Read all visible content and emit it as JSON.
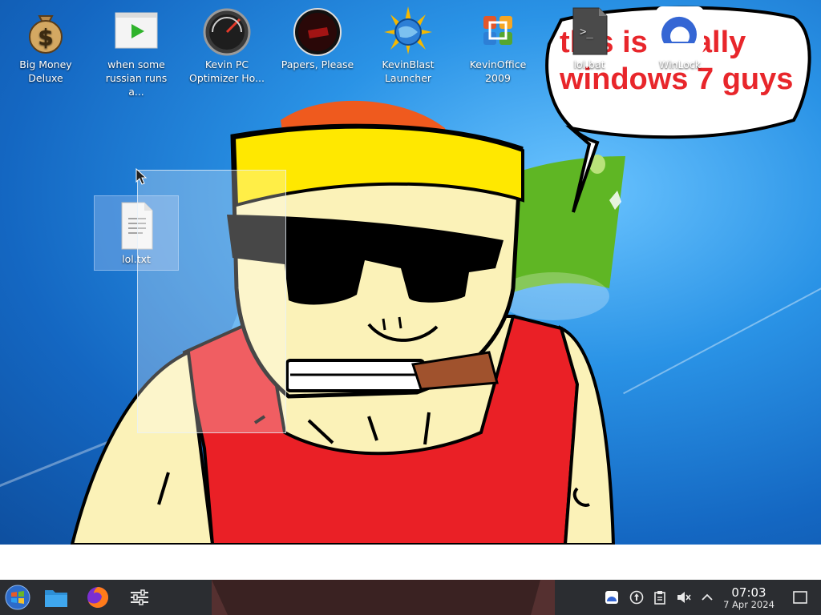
{
  "desktop": {
    "icons": [
      {
        "label": "Big Money Deluxe",
        "icon": "money-bag-icon"
      },
      {
        "label": "when some russian runs a...",
        "icon": "video-play-icon"
      },
      {
        "label": "Kevin PC Optimizer Ho...",
        "icon": "speedometer-icon"
      },
      {
        "label": "Papers, Please",
        "icon": "papers-please-icon"
      },
      {
        "label": "KevinBlast Launcher",
        "icon": "sun-globe-icon"
      },
      {
        "label": "KevinOffice 2009",
        "icon": "office-icon"
      },
      {
        "label": "lol.bat",
        "icon": "terminal-script-icon"
      },
      {
        "label": "WinLock",
        "icon": "lock-app-icon"
      },
      {
        "label": "lol.txt",
        "icon": "text-file-icon",
        "selected": true
      }
    ],
    "bubble": {
      "line1": "this is totally",
      "line2": "windows 7 guys"
    }
  },
  "taskbar": {
    "launchers": [
      {
        "name": "start-menu",
        "icon": "windows-orb-icon"
      },
      {
        "name": "file-manager",
        "icon": "folder-icon"
      },
      {
        "name": "firefox",
        "icon": "firefox-icon"
      },
      {
        "name": "settings",
        "icon": "sliders-icon"
      }
    ],
    "tray": [
      {
        "icon": "winlock-tray-icon"
      },
      {
        "icon": "update-tray-icon"
      },
      {
        "icon": "clipboard-icon"
      },
      {
        "icon": "volume-muted-icon"
      },
      {
        "icon": "chevron-up-icon"
      }
    ],
    "clock": {
      "time": "07:03",
      "date": "7 Apr 2024"
    }
  },
  "colors": {
    "bubble_text": "#e8262b",
    "taskbar": "#2b2d31",
    "selection": "rgba(255,255,255,0.28)"
  }
}
